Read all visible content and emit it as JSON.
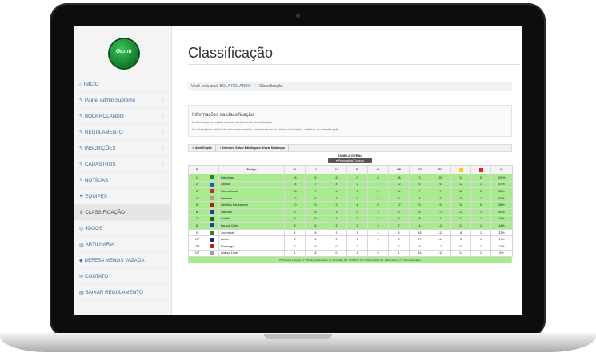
{
  "logo": {
    "text": "Gr.mir"
  },
  "sidebar": {
    "items": [
      {
        "label": "INÍCIO",
        "icon": "home-icon",
        "glyph": "⌂",
        "chevron": false
      },
      {
        "label": "Painel Admin Supremo",
        "icon": "wrench-icon",
        "glyph": "✎",
        "chevron": true
      },
      {
        "label": "BOLA ROLANDO",
        "icon": "wrench-icon",
        "glyph": "✎",
        "chevron": true
      },
      {
        "label": "REGULAMENTO",
        "icon": "wrench-icon",
        "glyph": "✎",
        "chevron": true
      },
      {
        "label": "INSCRIÇÕES",
        "icon": "wrench-icon",
        "glyph": "✎",
        "chevron": true
      },
      {
        "label": "CADASTROS",
        "icon": "wrench-icon",
        "glyph": "✎",
        "chevron": true
      },
      {
        "label": "NOTÍCIAS",
        "icon": "wrench-icon",
        "glyph": "✎",
        "chevron": true
      },
      {
        "label": "EQUIPES",
        "icon": "flag-icon",
        "glyph": "⚑",
        "chevron": false
      },
      {
        "label": "CLASSIFICAÇÃO",
        "icon": "trophy-icon",
        "glyph": "♛",
        "chevron": false,
        "active": true
      },
      {
        "label": "JOGOS",
        "icon": "ball-icon",
        "glyph": "◎",
        "chevron": false
      },
      {
        "label": "ARTILHARIA",
        "icon": "bar-chart-icon",
        "glyph": "▥",
        "chevron": false
      },
      {
        "label": "DEFESA MENOS VAZADA",
        "icon": "shield-icon",
        "glyph": "◆",
        "chevron": false
      },
      {
        "label": "CONTATO",
        "icon": "envelope-icon",
        "glyph": "✉",
        "chevron": false
      },
      {
        "label": "BAIXAR REGULAMENTO",
        "icon": "document-icon",
        "glyph": "▤",
        "chevron": false
      }
    ]
  },
  "page": {
    "title": "Classificação"
  },
  "breadcrumb": {
    "prefix": "Você está aqui:",
    "link": "BOLA ROLANDO",
    "separator": "/",
    "current": "Classificação"
  },
  "info": {
    "title": "Informações da classificação",
    "line1": "Ambiente para edição manual da tabela de classificação.",
    "line2": "A colocação é calculada automaticamente, considerando os dados da tabela e critérios de classificação."
  },
  "toolbar": {
    "open_edit": "Abrir Edição",
    "save_edit": "Selecione Salvar Edição para Gravar Mudanças"
  },
  "table": {
    "title": "TABELA GERAL",
    "customize": "Personalizar Colunas",
    "headers": [
      "P",
      "",
      "Equipe",
      "P",
      "J",
      "V",
      "E",
      "D",
      "GP",
      "GC",
      "SG",
      "",
      "",
      "%"
    ],
    "rows": [
      {
        "pos": "1º",
        "team": "Palmeiras",
        "crest": "#2e7d32",
        "p": "18",
        "j": "6",
        "v": "6",
        "e": "0",
        "d": "0",
        "gp": "28",
        "gc": "3",
        "sg": "25",
        "ca": "12",
        "cv": "0",
        "pct": "100%",
        "zone": "green"
      },
      {
        "pos": "2º",
        "team": "Galícia",
        "crest": "#1565c0",
        "p": "14",
        "j": "7",
        "v": "4",
        "e": "2",
        "d": "1",
        "gp": "12",
        "gc": "6",
        "sg": "6",
        "ca": "12",
        "cv": "1",
        "pct": "67%",
        "zone": "green"
      },
      {
        "pos": "3º",
        "team": "Internacional",
        "crest": "#c62828",
        "p": "13",
        "j": "7",
        "v": "4",
        "e": "1",
        "d": "2",
        "gp": "14",
        "gc": "7",
        "sg": "7",
        "ca": "16",
        "cv": "0",
        "pct": "62%",
        "zone": "green"
      },
      {
        "pos": "4º",
        "team": "Defensor",
        "crest": "#9e9e9e",
        "p": "12",
        "j": "6",
        "v": "4",
        "e": "0",
        "d": "2",
        "gp": "9",
        "gc": "4",
        "sg": "5",
        "ca": "9",
        "cv": "1",
        "pct": "67%",
        "zone": "green"
      },
      {
        "pos": "5º",
        "team": "Athletico Paranaense",
        "crest": "#b71c1c",
        "p": "10",
        "j": "6",
        "v": "2",
        "e": "4",
        "d": "0",
        "gp": "12",
        "gc": "6",
        "sg": "6",
        "ca": "16",
        "cv": "0",
        "pct": "56%",
        "zone": "green"
      },
      {
        "pos": "6º",
        "team": "Nacional",
        "crest": "#283593",
        "p": "9",
        "j": "6",
        "v": "3",
        "e": "0",
        "d": "3",
        "gp": "5",
        "gc": "6",
        "sg": "-1",
        "ca": "12",
        "cv": "1",
        "pct": "50%",
        "zone": "green"
      },
      {
        "pos": "7º",
        "team": "Coritiba",
        "crest": "#1b5e20",
        "p": "8",
        "j": "6",
        "v": "2",
        "e": "2",
        "d": "2",
        "gp": "9",
        "gc": "8",
        "sg": "1",
        "ca": "13",
        "cv": "1",
        "pct": "44%",
        "zone": "green"
      },
      {
        "pos": "8º",
        "team": "Paraná Clube",
        "crest": "#0d47a1",
        "p": "8",
        "j": "6",
        "v": "2",
        "e": "2",
        "d": "2",
        "gp": "2",
        "gc": "4",
        "sg": "-2",
        "ca": "13",
        "cv": "1",
        "pct": "44%",
        "zone": "green"
      },
      {
        "pos": "9º",
        "team": "Juventude",
        "crest": "#2e7d32",
        "p": "4",
        "j": "6",
        "v": "1",
        "e": "1",
        "d": "4",
        "gp": "5",
        "gc": "16",
        "sg": "-11",
        "ca": "8",
        "cv": "1",
        "pct": "22%",
        "zone": "white"
      },
      {
        "pos": "10º",
        "team": "Azuriz",
        "crest": "#1a237e",
        "p": "3",
        "j": "6",
        "v": "0",
        "e": "3",
        "d": "3",
        "gp": "3",
        "gc": "17",
        "sg": "-14",
        "ca": "8",
        "cv": "1",
        "pct": "17%",
        "zone": "white"
      },
      {
        "pos": "11º",
        "team": "Flamengo",
        "crest": "#b71c1c",
        "p": "2",
        "j": "6",
        "v": "0",
        "e": "2",
        "d": "4",
        "gp": "2",
        "gc": "9",
        "sg": "-7",
        "ca": "10",
        "cv": "1",
        "pct": "11%",
        "zone": "white"
      },
      {
        "pos": "12º",
        "team": "Aliança Lima",
        "crest": "#9e9e9e",
        "p": "1",
        "j": "6",
        "v": "0",
        "e": "1",
        "d": "5",
        "gp": "1",
        "gc": "16",
        "sg": "-15",
        "ca": "14",
        "cv": "1",
        "pct": "6%",
        "zone": "white"
      }
    ],
    "legend": "P: Pontos | J: Jogos | V: Vitórias | E: Empates | D: Derrotas | GP: Gols Pró | GC: Gols Contra | SG: Saldo de Gol | %: Aproveitamento"
  },
  "colors": {
    "zone_green": "#a8ea8e",
    "link_blue": "#2e6da4",
    "yellow_card": "#f5d40a",
    "red_card": "#e0271c"
  }
}
